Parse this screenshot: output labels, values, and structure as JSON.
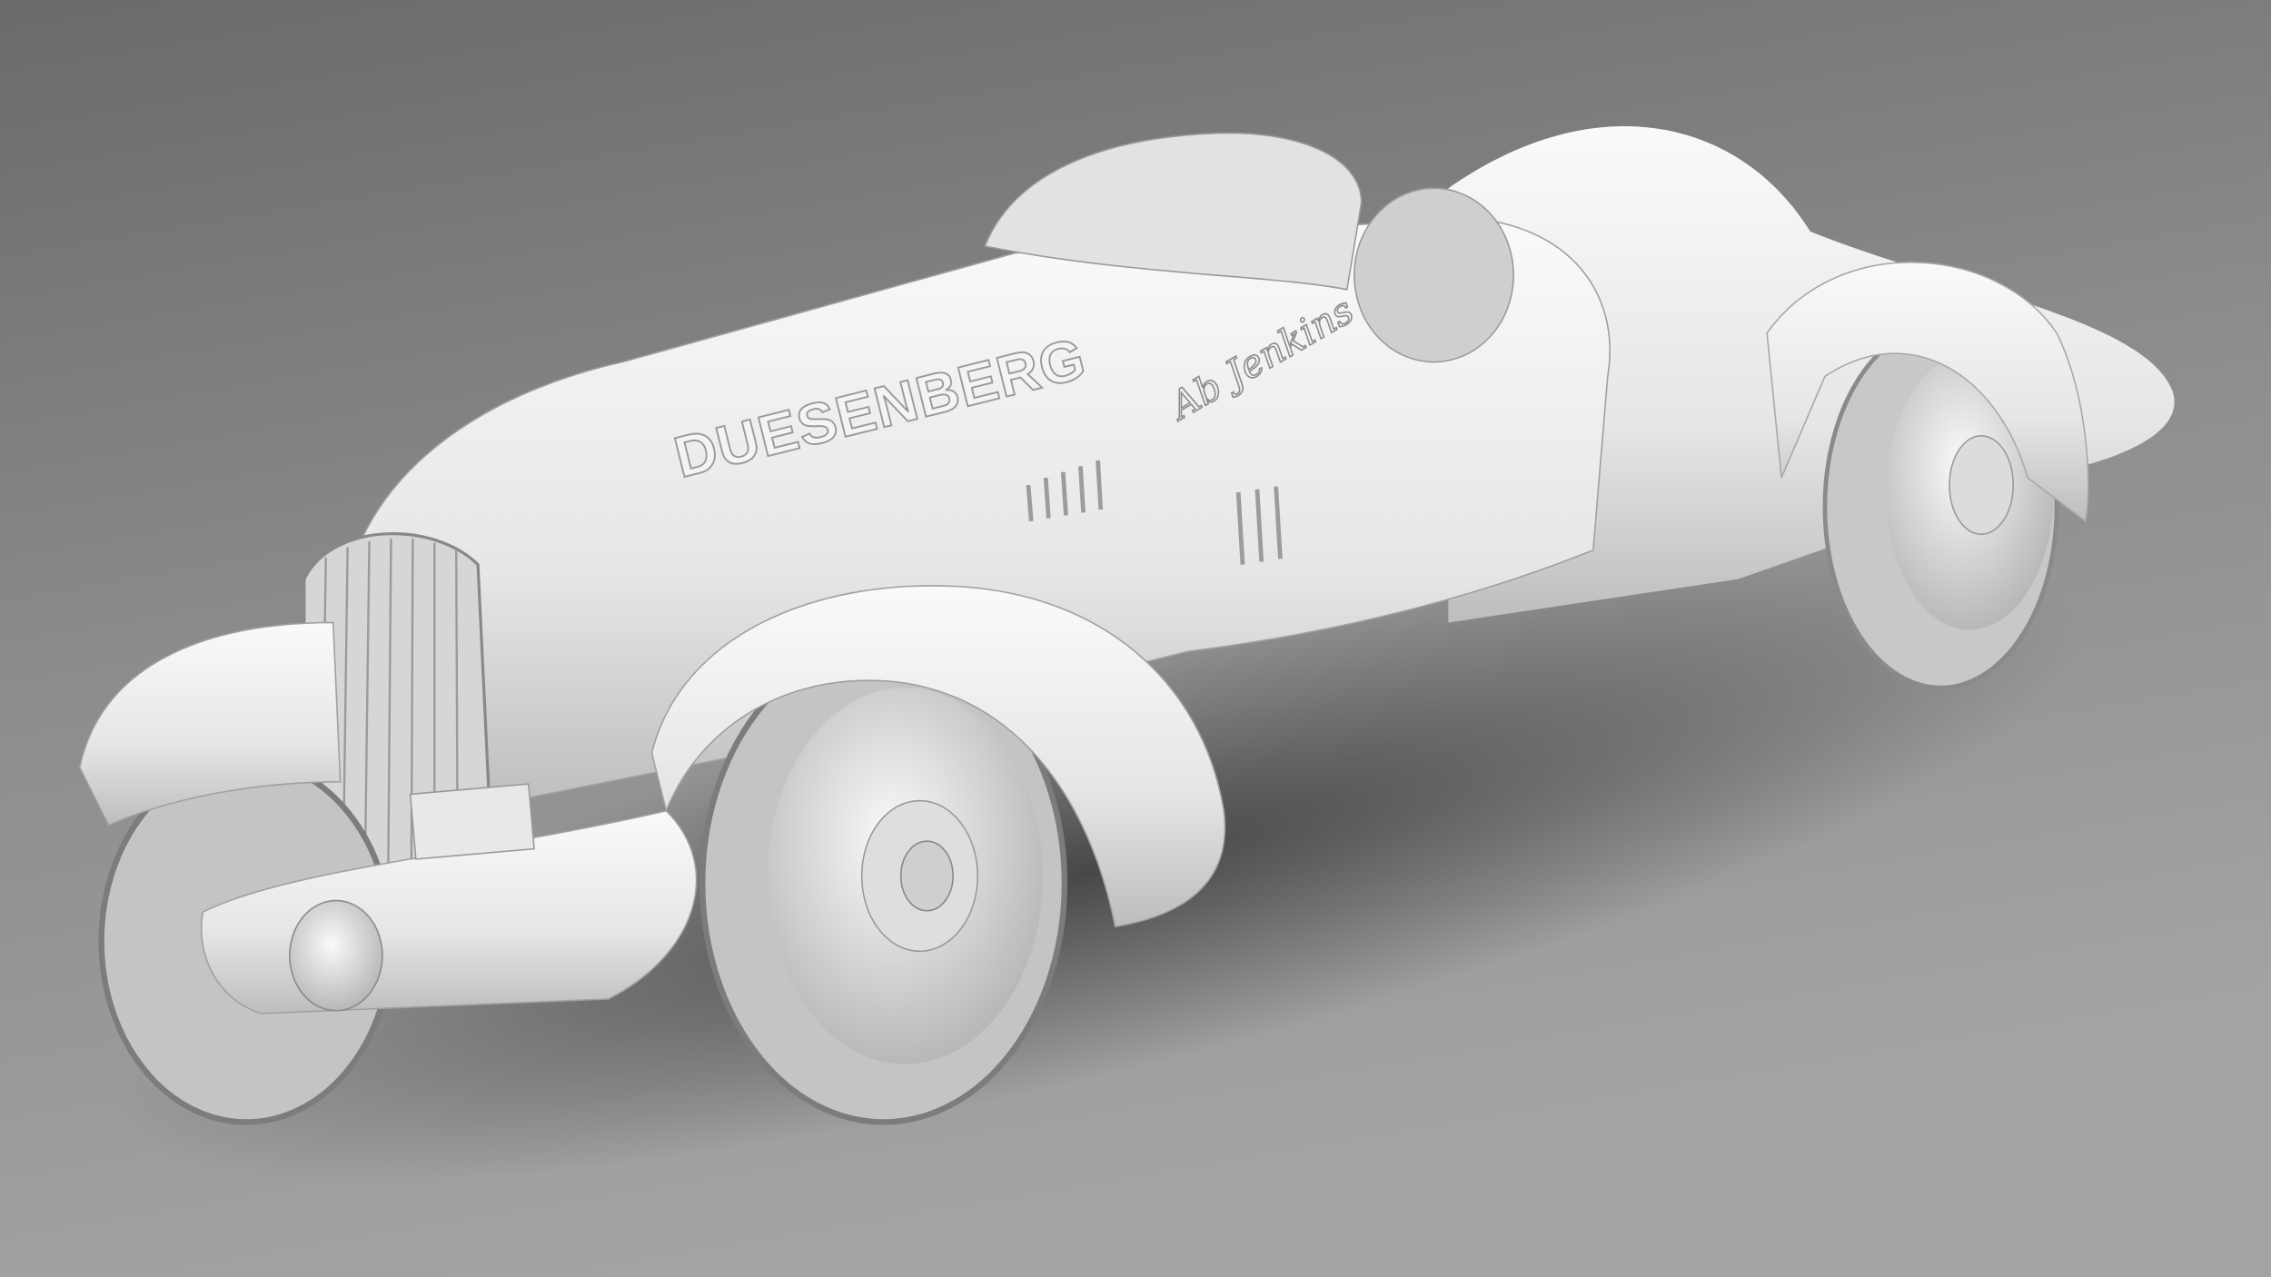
{
  "image": {
    "subject": "Duesenberg Special racing roadster 3D clay render",
    "hood_lettering": "DUESENBERG",
    "signature": "Ab Jenkins",
    "colors": {
      "background_top": "#6e6e6e",
      "background_bottom": "#a8a8a8",
      "body": "#e8e8e8",
      "tire": "#d0d0d0",
      "shadow": "#5a5a5a"
    }
  }
}
